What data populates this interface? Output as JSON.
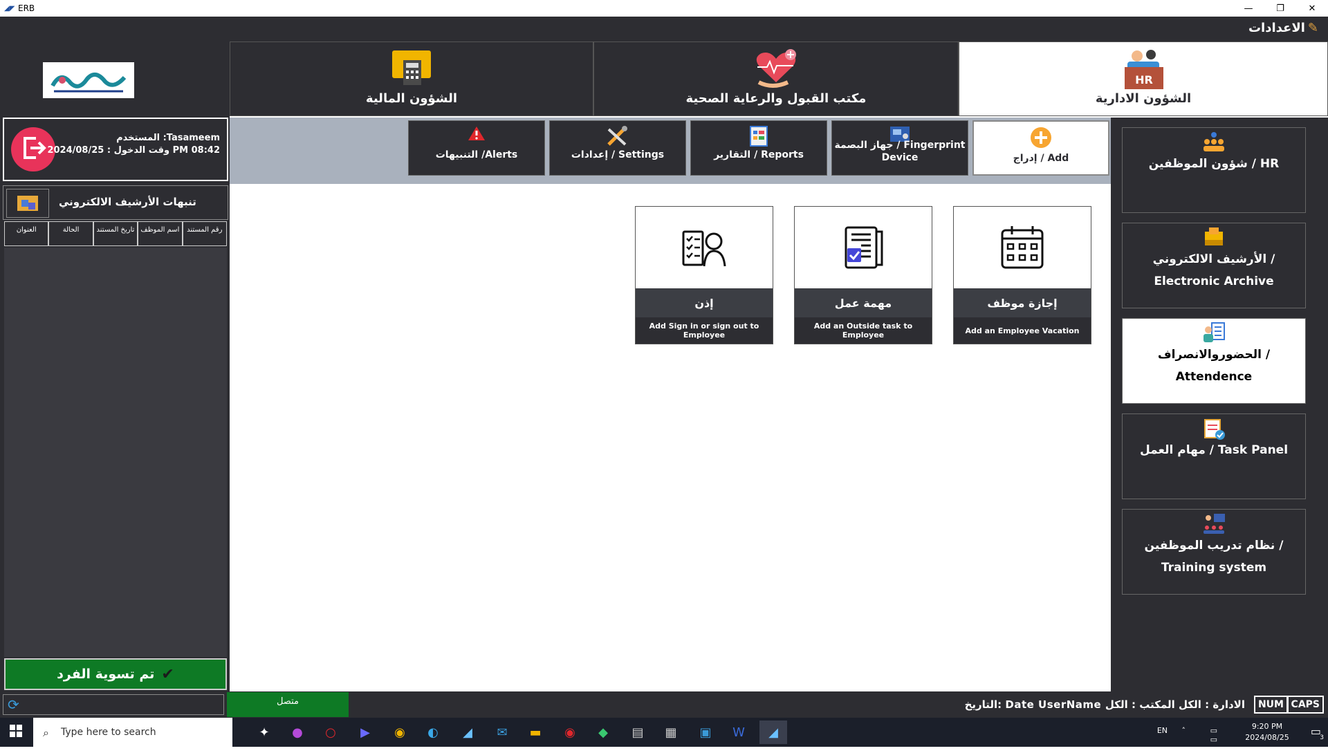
{
  "window": {
    "title": "ERB"
  },
  "menubar": {
    "settings_label": "الاعدادات"
  },
  "top_nav": [
    {
      "label": "الشؤون المالية",
      "icon": "calculator-folder-icon"
    },
    {
      "label": "مكتب القبول والرعاية الصحية",
      "icon": "heart-care-icon"
    },
    {
      "label": "الشؤون الادارية",
      "icon": "hr-icon",
      "active": true
    }
  ],
  "user": {
    "line1": "المستخدم :Tasameem",
    "line2": "وقت الدخول : 2024/08/25 PM 08:42"
  },
  "archive_alerts": {
    "title": "تنبهات الأرشيف الالكتروني",
    "columns": [
      "رقم المستند",
      "اسم الموظف",
      "تاريخ المستند",
      "الحالة",
      "العنوان"
    ]
  },
  "settled_button": "تم تسوية الفرد",
  "sub_nav": [
    {
      "label": "إدراج / Add",
      "icon": "plus-icon",
      "active": true
    },
    {
      "label": "جهاز البصمة / Fingerprint Device",
      "icon": "fingerprint-device-icon"
    },
    {
      "label": "التقارير / Reports",
      "icon": "reports-icon"
    },
    {
      "label": "إعدادات / Settings",
      "icon": "tools-icon"
    },
    {
      "label": "التنبيهات /Alerts",
      "icon": "warning-icon"
    }
  ],
  "cards": [
    {
      "title": "إجازة موظف",
      "desc": "Add an Employee Vacation",
      "icon": "calendar-icon"
    },
    {
      "title": "مهمة عمل",
      "desc": "Add an Outside task to Employee",
      "icon": "task-document-icon"
    },
    {
      "title": "إذن",
      "desc": "Add Sign in or sign out to Employee",
      "icon": "checklist-person-icon"
    }
  ],
  "right_menu": [
    {
      "label": "شؤون الموظفين / HR",
      "icon": "employees-icon"
    },
    {
      "label": "الأرشيف الالكتروني / Electronic Archive",
      "icon": "archive-icon"
    },
    {
      "label": "الحضوروالانصراف / Attendence",
      "icon": "attendance-icon",
      "active": true
    },
    {
      "label": "مهام العمل / Task Panel",
      "icon": "task-panel-icon"
    },
    {
      "label": "نظام تدريب الموظفين / Training system",
      "icon": "training-icon"
    }
  ],
  "status": {
    "connection": "متصل",
    "info": "التاريخ: Date  UserName  الادارة : الكل المكتب : الكل",
    "num": "NUM",
    "caps": "CAPS"
  },
  "taskbar": {
    "search_placeholder": "Type here to search",
    "lang": "EN",
    "time": "9:20 PM",
    "date": "2024/08/25",
    "notifications": "3"
  },
  "colors": {
    "panel": "#2d2d32",
    "accent_green": "#0e7a25",
    "logout_red": "#e8335a",
    "subnav_bg": "#a9b1bd"
  }
}
